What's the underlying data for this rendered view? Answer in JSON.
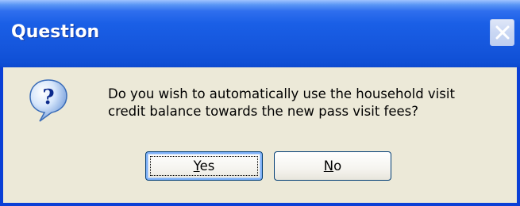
{
  "window": {
    "title": "Question",
    "close_icon": "close-icon",
    "colors": {
      "title_bar": "#1556dc",
      "frame": "#0a3fd6",
      "body": "#ece9d8"
    }
  },
  "dialog": {
    "icon": "question-icon",
    "message_line1": "Do you wish to automatically use the household visit",
    "message_line2": "credit balance towards the new pass visit fees?",
    "buttons": {
      "yes_first": "Y",
      "yes_rest": "es",
      "no_first": "N",
      "no_rest": "o"
    }
  }
}
